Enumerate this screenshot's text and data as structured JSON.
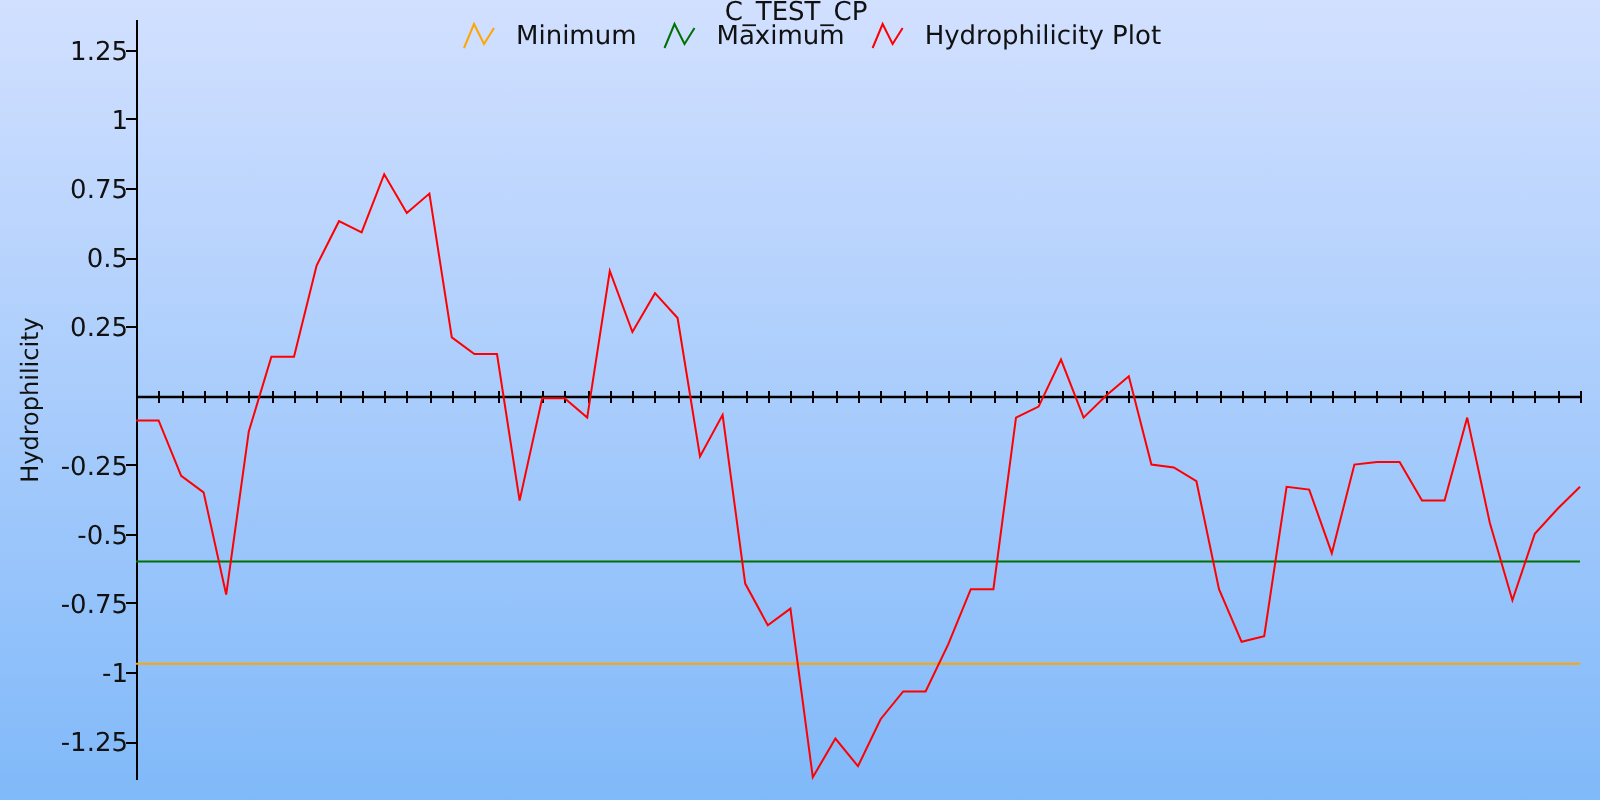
{
  "chart_data": {
    "type": "line",
    "title": "C_TEST_CP",
    "legend": "upper center",
    "ylabel": "Hydrophilicity",
    "ylim": [
      -1.39,
      1.43
    ],
    "yticks": [
      1.25,
      1,
      0.75,
      0.5,
      0.25,
      -0.25,
      -0.5,
      -0.75,
      -1,
      -1.25
    ],
    "series": [
      {
        "name": "Minimum",
        "color": "#ffa500",
        "values": [
          -0.97,
          -0.97,
          -0.97,
          -0.97,
          -0.97,
          -0.97,
          -0.97,
          -0.97,
          -0.97,
          -0.97,
          -0.97,
          -0.97,
          -0.97,
          -0.97,
          -0.97,
          -0.97,
          -0.97,
          -0.97,
          -0.97,
          -0.97,
          -0.97,
          -0.97,
          -0.97,
          -0.97,
          -0.97,
          -0.97,
          -0.97,
          -0.97,
          -0.97,
          -0.97,
          -0.97,
          -0.97,
          -0.97,
          -0.97,
          -0.97,
          -0.97,
          -0.97,
          -0.97,
          -0.97,
          -0.97,
          -0.97,
          -0.97,
          -0.97,
          -0.97,
          -0.97,
          -0.97,
          -0.97,
          -0.97,
          -0.97,
          -0.97,
          -0.97,
          -0.97,
          -0.97,
          -0.97,
          -0.97,
          -0.97,
          -0.97,
          -0.97,
          -0.97,
          -0.97,
          -0.97,
          -0.97,
          -0.97,
          -0.97,
          -0.97
        ]
      },
      {
        "name": "Maximum",
        "color": "#007000",
        "values": [
          -0.6,
          -0.6,
          -0.6,
          -0.6,
          -0.6,
          -0.6,
          -0.6,
          -0.6,
          -0.6,
          -0.6,
          -0.6,
          -0.6,
          -0.6,
          -0.6,
          -0.6,
          -0.6,
          -0.6,
          -0.6,
          -0.6,
          -0.6,
          -0.6,
          -0.6,
          -0.6,
          -0.6,
          -0.6,
          -0.6,
          -0.6,
          -0.6,
          -0.6,
          -0.6,
          -0.6,
          -0.6,
          -0.6,
          -0.6,
          -0.6,
          -0.6,
          -0.6,
          -0.6,
          -0.6,
          -0.6,
          -0.6,
          -0.6,
          -0.6,
          -0.6,
          -0.6,
          -0.6,
          -0.6,
          -0.6,
          -0.6,
          -0.6,
          -0.6,
          -0.6,
          -0.6,
          -0.6,
          -0.6,
          -0.6,
          -0.6,
          -0.6,
          -0.6,
          -0.6,
          -0.6,
          -0.6,
          -0.6,
          -0.6,
          -0.6
        ]
      },
      {
        "name": "Hydrophilicity Plot",
        "color": "#ff0000",
        "values": [
          -0.09,
          -0.09,
          -0.29,
          -0.35,
          -0.72,
          -0.13,
          0.14,
          0.14,
          0.47,
          0.63,
          0.59,
          0.8,
          0.66,
          0.73,
          0.21,
          0.15,
          0.15,
          -0.38,
          -0.01,
          -0.01,
          -0.08,
          0.45,
          0.23,
          0.37,
          0.28,
          -0.22,
          -0.07,
          -0.68,
          -0.83,
          -0.77,
          -1.38,
          -1.24,
          -1.34,
          -1.17,
          -1.07,
          -1.07,
          -0.9,
          -0.7,
          -0.7,
          -0.08,
          -0.04,
          0.13,
          -0.08,
          0,
          0.07,
          -0.25,
          -0.26,
          -0.31,
          -0.7,
          -0.89,
          -0.87,
          -0.33,
          -0.34,
          -0.57,
          -0.25,
          -0.24,
          -0.24,
          -0.38,
          -0.38,
          -0.08,
          -0.46,
          -0.74,
          -0.5,
          -0.41,
          -0.33
        ]
      }
    ]
  }
}
